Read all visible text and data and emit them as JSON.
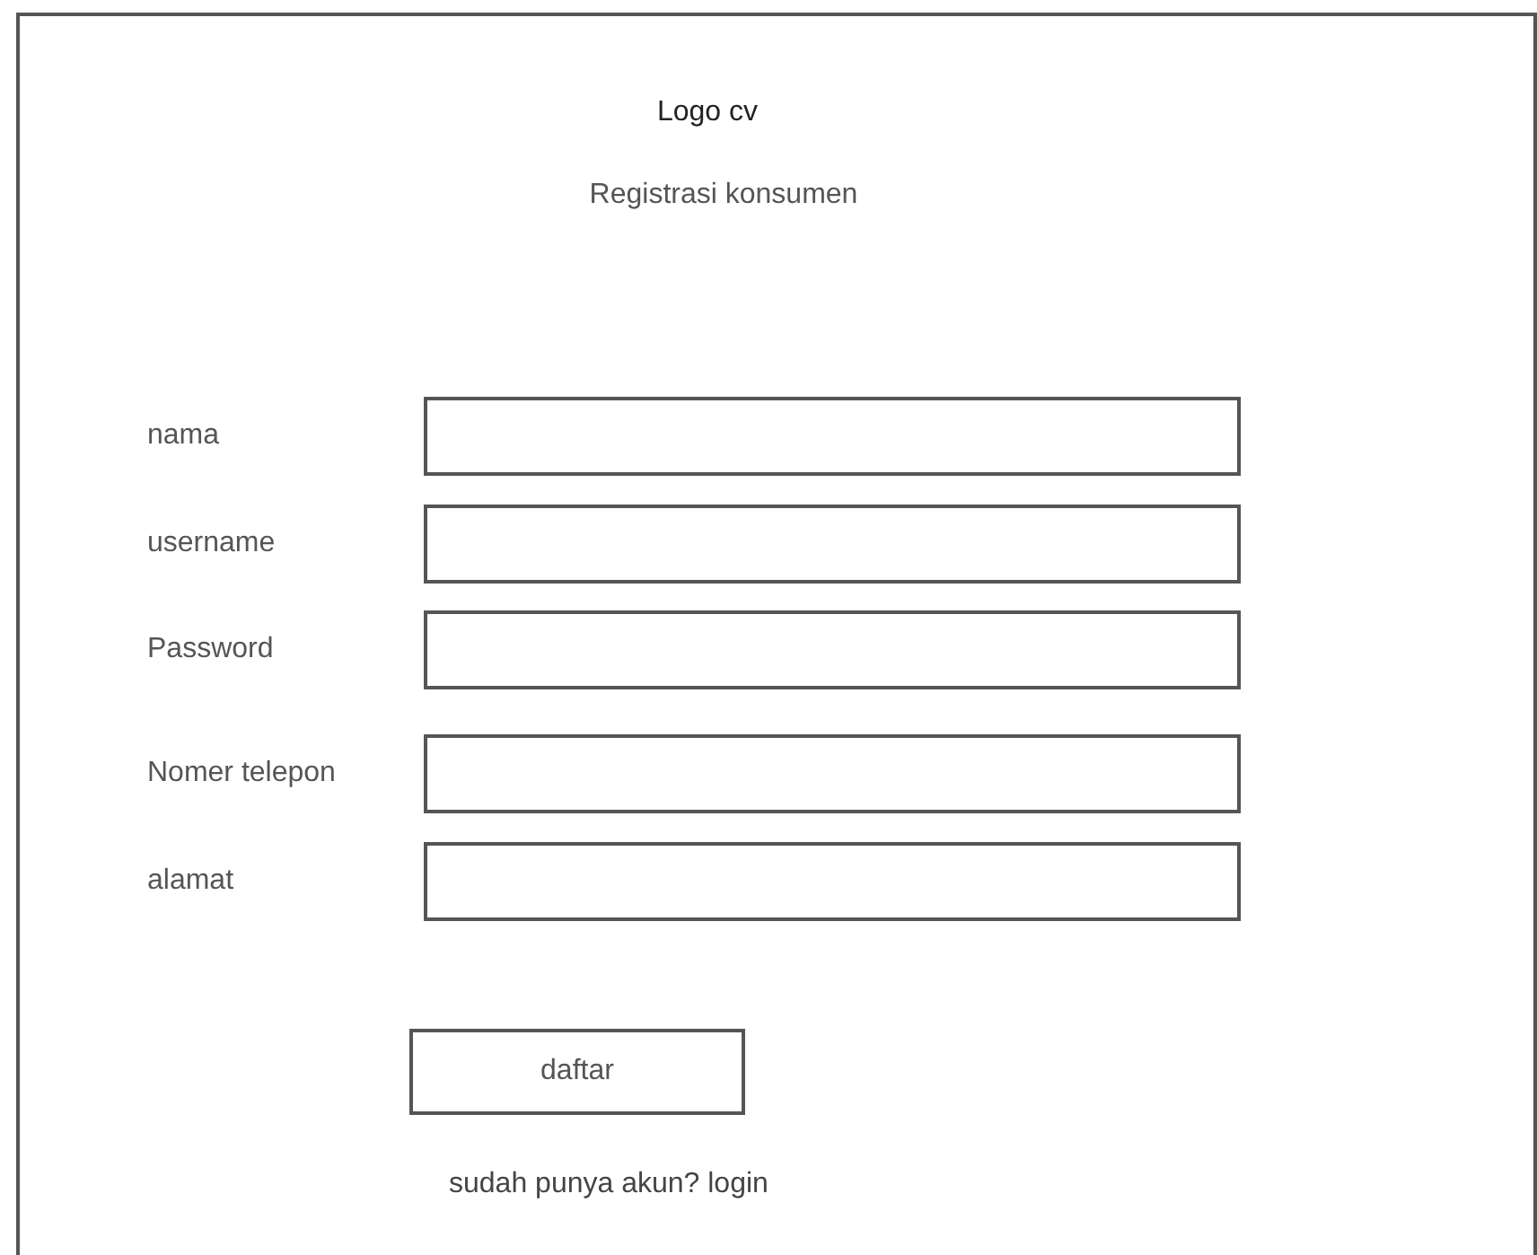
{
  "header": {
    "logo": "Logo cv",
    "title": "Registrasi konsumen"
  },
  "fields": [
    {
      "label": "nama"
    },
    {
      "label": "username"
    },
    {
      "label": "Password"
    },
    {
      "label": "Nomer telepon"
    },
    {
      "label": "alamat"
    }
  ],
  "submit_button": "daftar",
  "login_prompt": "sudah punya akun? login"
}
